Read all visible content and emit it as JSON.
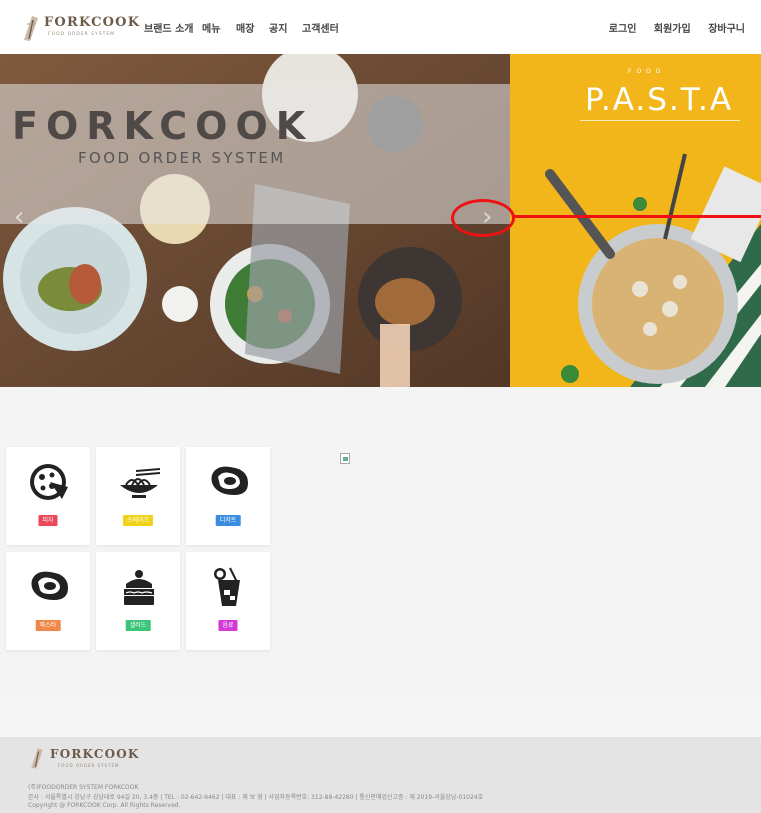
{
  "header": {
    "logo_text": "FORKCOOK",
    "logo_sub": "FOOD ORDER SYSTEM",
    "nav": [
      "브랜드 소개",
      "메뉴",
      "매장",
      "공지",
      "고객센터"
    ],
    "user_nav": [
      "로그인",
      "회원가입",
      "장바구니"
    ]
  },
  "hero": {
    "brand": "FORKCOOK",
    "subtitle": "FOOD ORDER SYSTEM",
    "pasta_small": "FOOD",
    "pasta_title": "P.A.S.T.A",
    "prev_arrow": "‹",
    "next_arrow": "›"
  },
  "categories": [
    {
      "label": "피자",
      "color": "#e8485a",
      "icon": "pizza-icon"
    },
    {
      "label": "스테이크",
      "color": "#f0d21a",
      "icon": "noodle-bowl-icon"
    },
    {
      "label": "디저트",
      "color": "#3b8de0",
      "icon": "steak-icon"
    },
    {
      "label": "파스타",
      "color": "#f0884a",
      "icon": "steak-icon"
    },
    {
      "label": "샐러드",
      "color": "#3cc47a",
      "icon": "cake-icon"
    },
    {
      "label": "음료",
      "color": "#d23ad8",
      "icon": "drink-icon"
    }
  ],
  "footer": {
    "logo_text": "FORKCOOK",
    "logo_sub": "FOOD ORDER SYSTEM",
    "company": "(주)FOODORDER SYSTEM FORKCOOK",
    "address": "본사 : 서울특별시 강남구 강남대로 94길 20, 3.4층 | TEL : 02-642-6462 | 대표 : 제 보 영 | 사업자등록번호: 312-88-42280 | 통신판매업신고증 : 제 2019-서울강남-01024호",
    "copyright": "Copyright @ FORKCOOK Corp. All Rights Reserved."
  },
  "colors": {
    "highlight": "#ee1111",
    "pasta_bg": "#f2b61a"
  }
}
